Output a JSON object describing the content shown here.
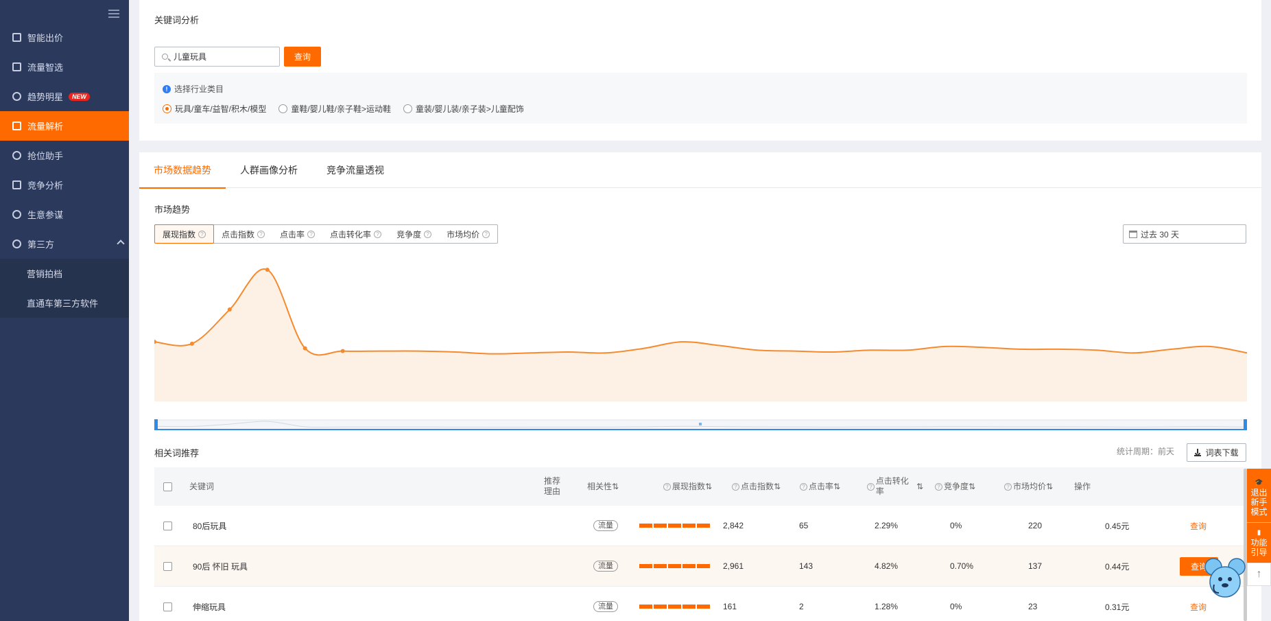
{
  "sidebar": {
    "items": [
      {
        "label": "智能出价",
        "icon": "bid-icon"
      },
      {
        "label": "流量智选",
        "icon": "traffic-select-icon"
      },
      {
        "label": "趋势明星",
        "icon": "trend-star-icon",
        "badge": "NEW"
      },
      {
        "label": "流量解析",
        "icon": "traffic-analysis-icon",
        "active": true
      },
      {
        "label": "抢位助手",
        "icon": "position-helper-icon"
      },
      {
        "label": "竞争分析",
        "icon": "competition-icon"
      },
      {
        "label": "生意参谋",
        "icon": "business-advisor-icon"
      },
      {
        "label": "第三方",
        "icon": "third-party-icon",
        "expanded": true
      }
    ],
    "subitems": [
      {
        "label": "营销拍档"
      },
      {
        "label": "直通车第三方软件"
      }
    ]
  },
  "keyword_section": {
    "title": "关键词分析",
    "search_value": "儿童玩具",
    "search_button": "查询",
    "category_label": "选择行业类目",
    "categories": [
      {
        "label": "玩具/童车/益智/积木/模型",
        "selected": true
      },
      {
        "label": "童鞋/婴儿鞋/亲子鞋>运动鞋",
        "selected": false
      },
      {
        "label": "童装/婴儿装/亲子装>儿童配饰",
        "selected": false
      }
    ]
  },
  "tabs": [
    {
      "label": "市场数据趋势",
      "active": true
    },
    {
      "label": "人群画像分析",
      "active": false
    },
    {
      "label": "竞争流量透视",
      "active": false
    }
  ],
  "market_trend": {
    "title": "市场趋势",
    "metrics": [
      {
        "label": "展现指数",
        "active": true
      },
      {
        "label": "点击指数",
        "active": false
      },
      {
        "label": "点击率",
        "active": false
      },
      {
        "label": "点击转化率",
        "active": false
      },
      {
        "label": "竞争度",
        "active": false
      },
      {
        "label": "市场均价",
        "active": false
      }
    ],
    "date_range": "过去 30 天"
  },
  "chart_data": {
    "type": "area",
    "title": "",
    "xlabel": "",
    "ylabel": "",
    "series": [
      {
        "values": [
          40,
          38,
          75,
          118,
          33,
          30,
          30,
          30,
          29,
          27,
          28,
          29,
          28,
          33,
          40,
          36,
          31,
          30,
          29,
          31,
          31,
          35,
          34,
          32,
          32,
          31,
          28,
          32,
          35,
          28
        ]
      }
    ],
    "ylim": [
      0,
      130
    ],
    "grid": false,
    "color": "#f58a2e",
    "fill_color": "#fdf1e6"
  },
  "related": {
    "title": "相关词推荐",
    "period_label": "统计周期：前天",
    "download_label": "词表下载",
    "columns": [
      "关键词",
      "推荐理由",
      "相关性",
      "展现指数",
      "点击指数",
      "点击率",
      "点击转化率",
      "竞争度",
      "市场均价",
      "操作"
    ],
    "rows": [
      {
        "keyword": "80后玩具",
        "tag": "流量",
        "impressions": "2,842",
        "clicks": "65",
        "ctr": "2.29%",
        "cvr": "0%",
        "competition": "220",
        "price": "0.45元",
        "action": "查询",
        "hover": false
      },
      {
        "keyword": "90后 怀旧 玩具",
        "tag": "流量",
        "impressions": "2,961",
        "clicks": "143",
        "ctr": "4.82%",
        "cvr": "0.70%",
        "competition": "137",
        "price": "0.44元",
        "action": "查询",
        "hover": true
      },
      {
        "keyword": "伸缩玩具",
        "tag": "流量",
        "impressions": "161",
        "clicks": "2",
        "ctr": "1.28%",
        "cvr": "0%",
        "competition": "23",
        "price": "0.31元",
        "action": "查询",
        "hover": false
      }
    ]
  },
  "float_panel": {
    "exit_label": "退出新手模式",
    "guide_label": "功能引导"
  },
  "colors": {
    "accent": "#ff6a00",
    "sidebar_bg": "#2b3a5c"
  }
}
